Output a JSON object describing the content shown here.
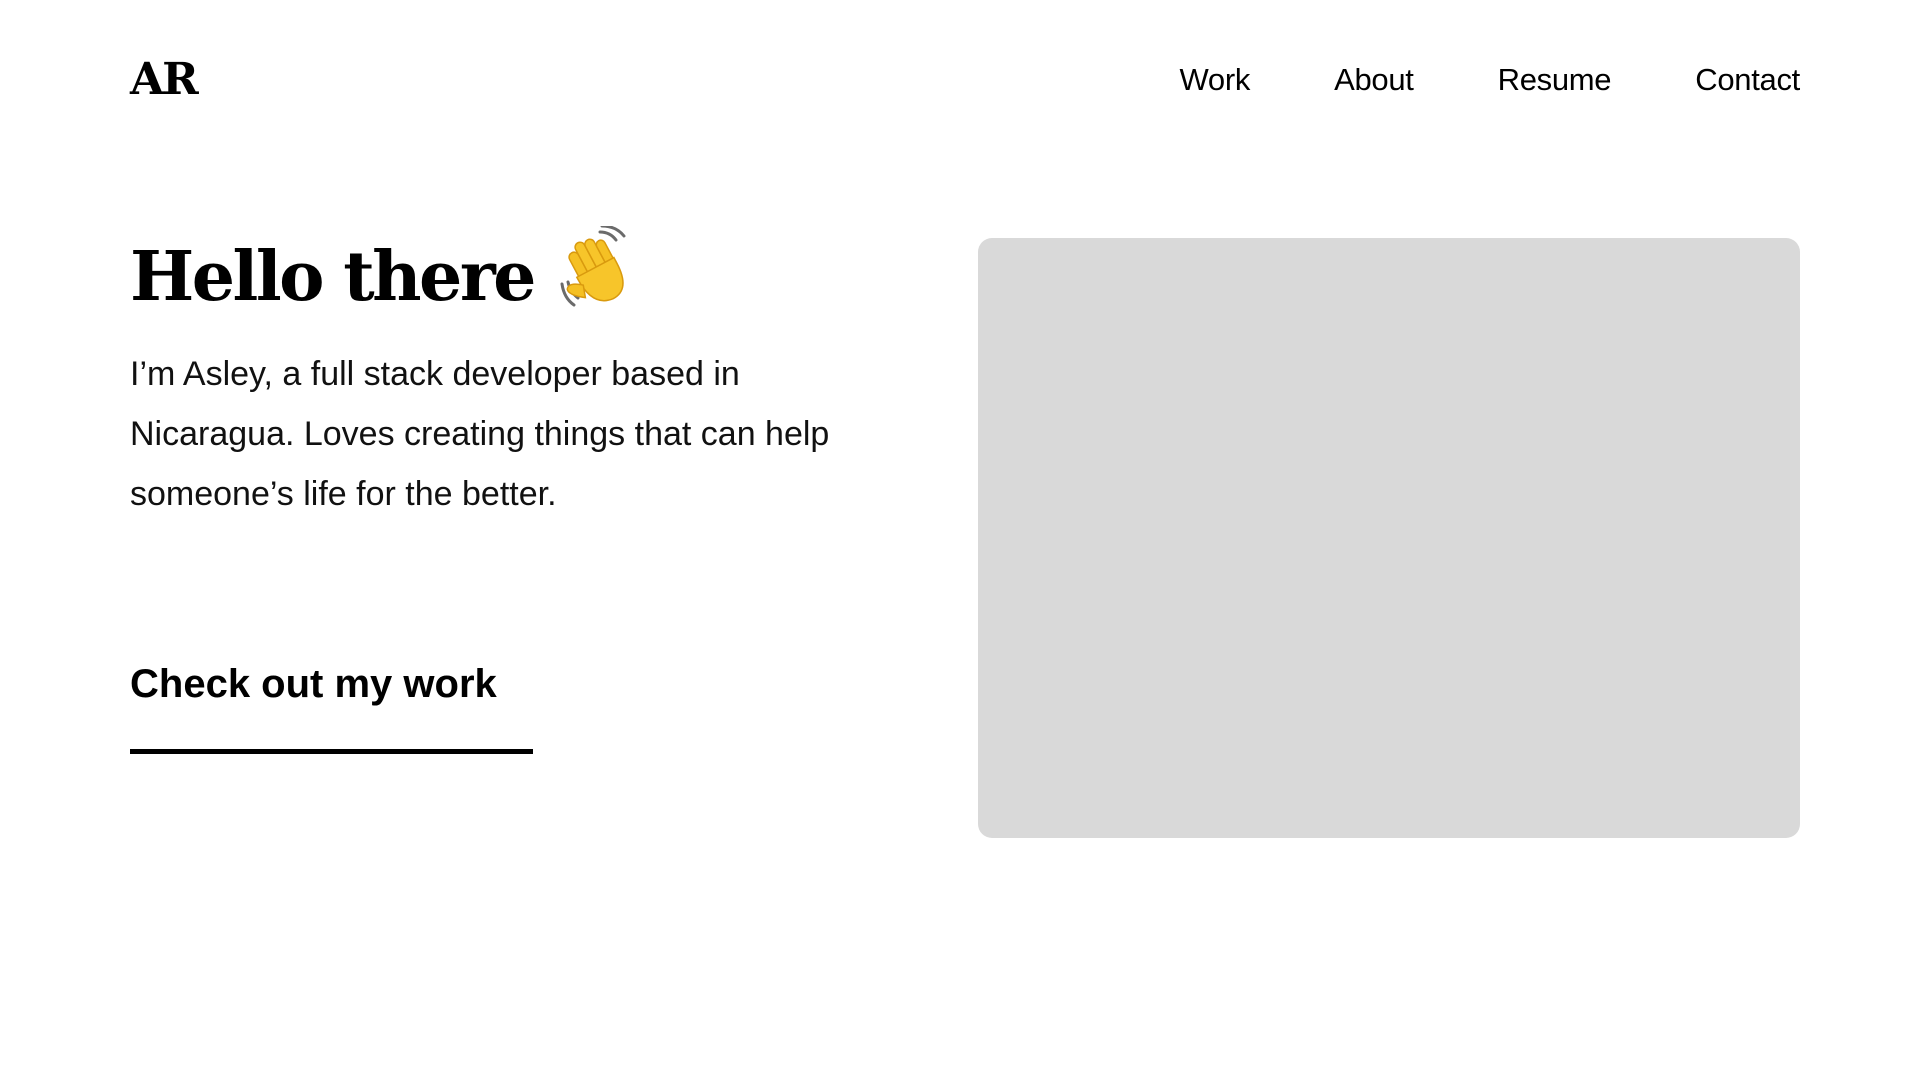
{
  "header": {
    "logo": "AR",
    "nav": [
      {
        "label": "Work"
      },
      {
        "label": "About"
      },
      {
        "label": "Resume"
      },
      {
        "label": "Contact"
      }
    ]
  },
  "hero": {
    "title": "Hello there",
    "title_icon": "waving-hand-icon",
    "description": "I’m Asley, a full stack developer based in Nicaragua. Loves creating things that can help someone’s life for the better.",
    "cta_label": "Check out my work",
    "image_placeholder_color": "#d9d9d9"
  }
}
